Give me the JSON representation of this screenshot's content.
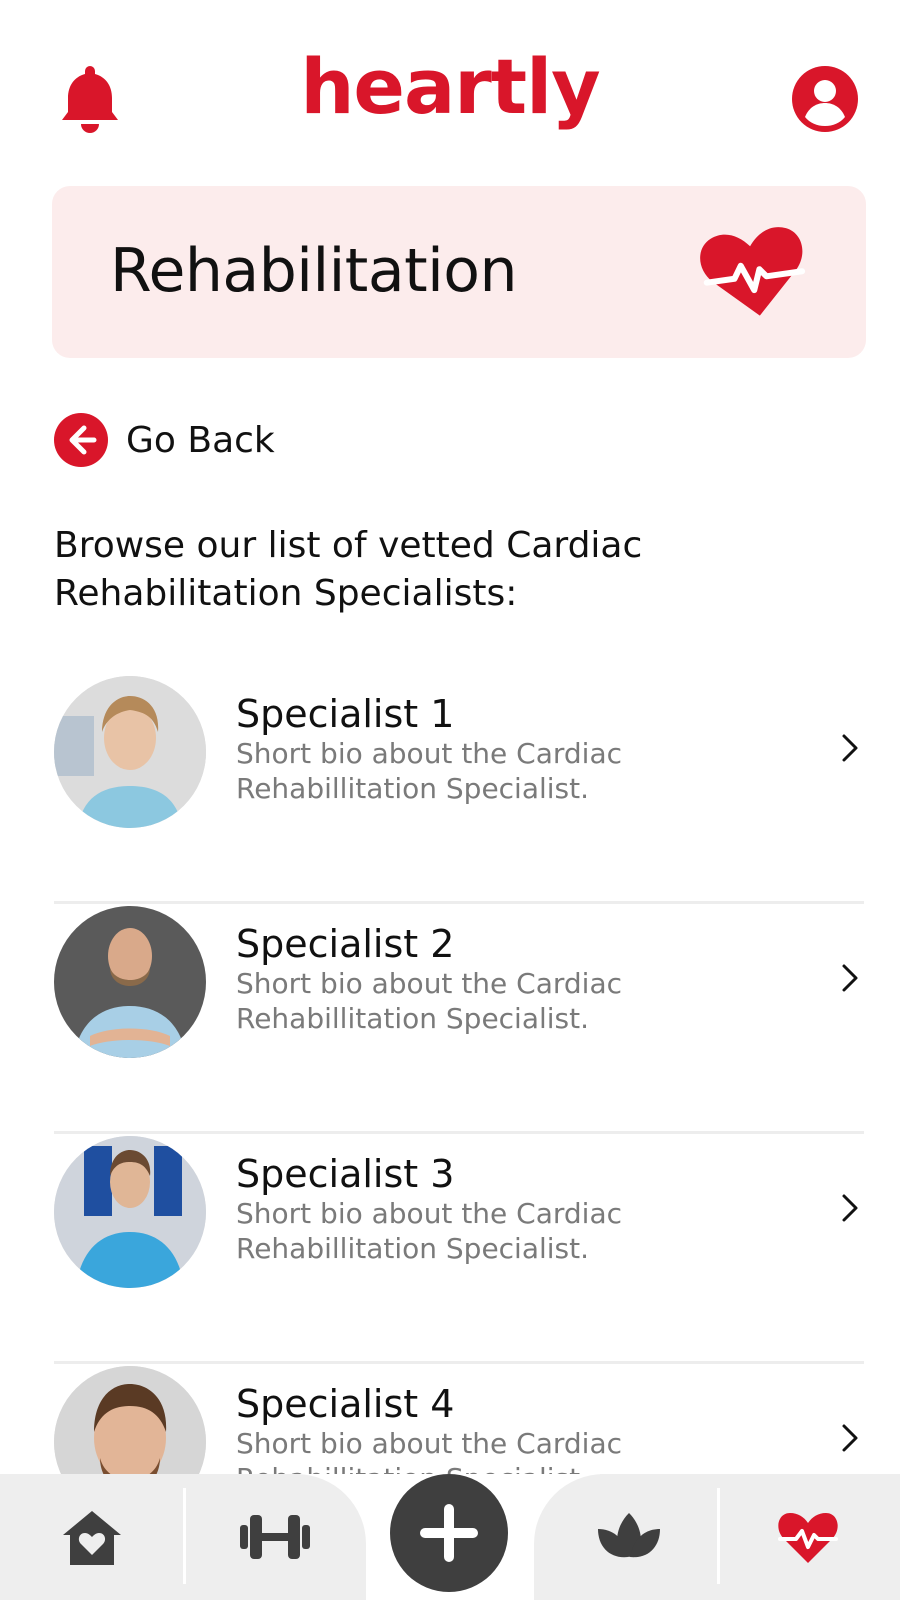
{
  "app": {
    "logo": "heartly"
  },
  "banner": {
    "title": "Rehabilitation"
  },
  "nav_back": {
    "label": "Go Back"
  },
  "intro": {
    "text": "Browse our list of vetted Cardiac Rehabilitation Specialists:"
  },
  "specialists": [
    {
      "name": "Specialist 1",
      "bio": "Short bio about the Cardiac Rehabillitation Specialist."
    },
    {
      "name": "Specialist 2",
      "bio": "Short bio about the Cardiac Rehabillitation Specialist."
    },
    {
      "name": "Specialist 3",
      "bio": "Short bio about the Cardiac Rehabillitation Specialist."
    },
    {
      "name": "Specialist 4",
      "bio": "Short bio about the Cardiac Rehabillitation Specialist."
    }
  ],
  "bottom_nav": {
    "items": [
      {
        "icon": "home-heart-icon"
      },
      {
        "icon": "dumbbell-icon"
      },
      {
        "icon": "plus-icon"
      },
      {
        "icon": "lotus-icon"
      },
      {
        "icon": "heart-pulse-icon",
        "active": true
      }
    ]
  },
  "colors": {
    "brand": "#d9162a",
    "banner_bg": "#fcecec",
    "nav_bg": "#eeeeee",
    "nav_icon": "#3f3f3f",
    "muted_text": "#7a7a7a"
  }
}
